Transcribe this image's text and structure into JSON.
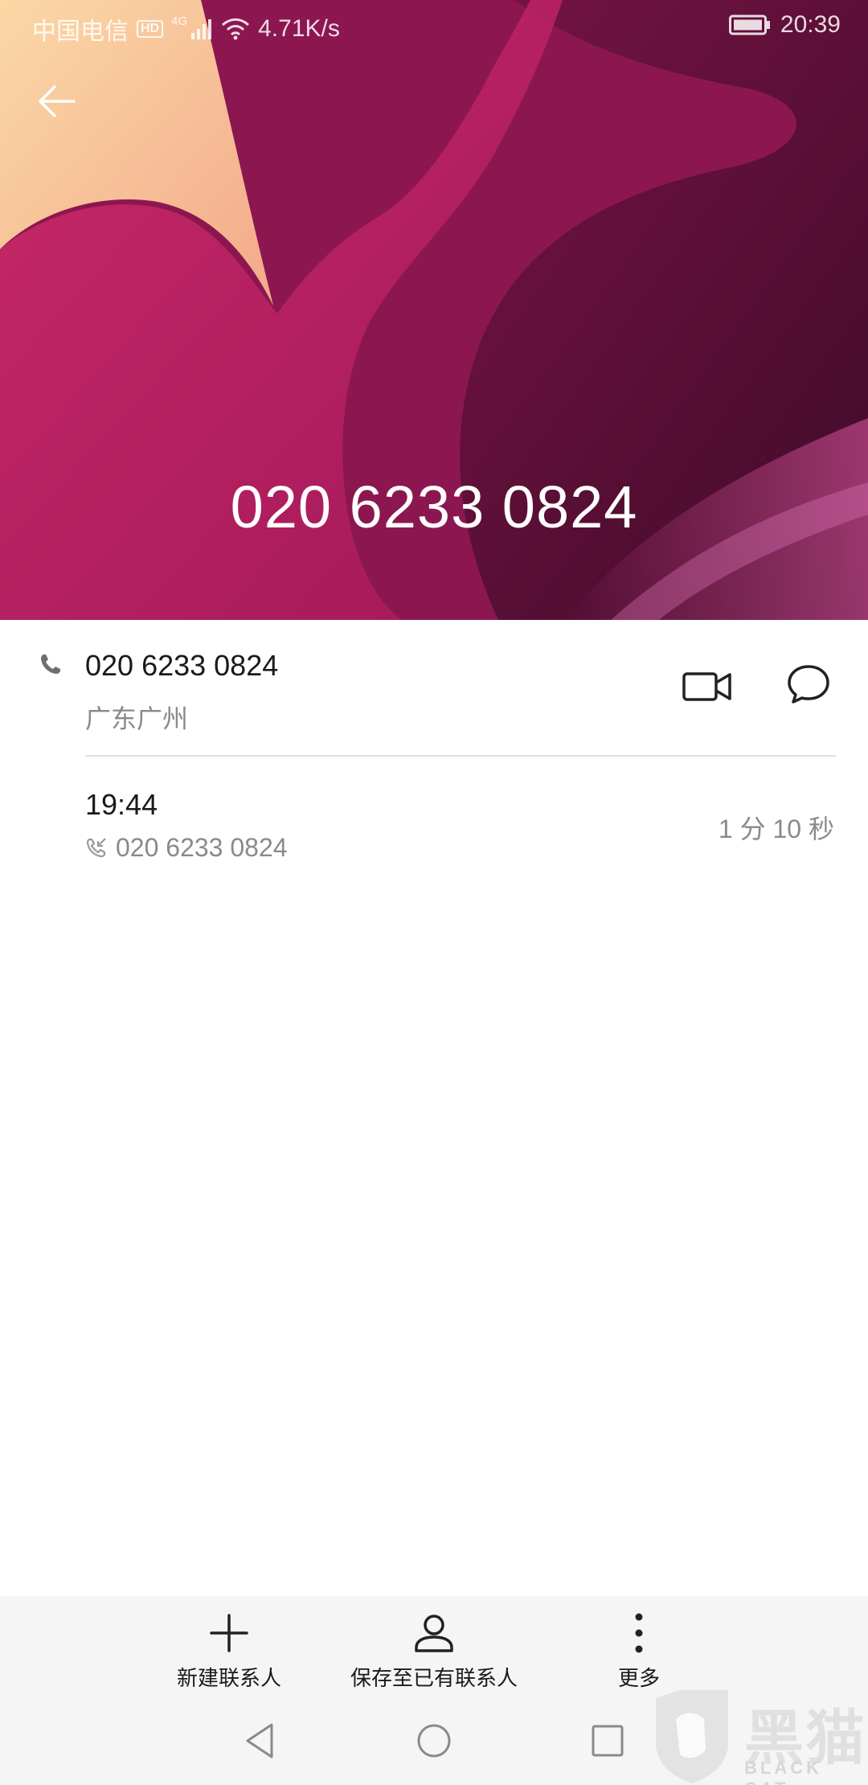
{
  "status_bar": {
    "carrier": "中国电信",
    "hd_badge": "HD",
    "network_type": "4G",
    "speed": "4.71K/s",
    "time": "20:39",
    "icons": [
      "signal-icon",
      "wifi-icon",
      "battery-icon"
    ]
  },
  "header": {
    "phone_number": "020 6233 0824",
    "back_icon": "arrow-left-icon"
  },
  "contact": {
    "number": "020 6233 0824",
    "location": "广东广州",
    "actions": [
      "video-call-icon",
      "message-icon"
    ]
  },
  "call_log": {
    "time": "19:44",
    "number": "020 6233 0824",
    "duration": "1 分 10 秒",
    "direction_icon": "incoming-call-icon"
  },
  "action_bar": {
    "new_contact_label": "新建联系人",
    "save_existing_label": "保存至已有联系人",
    "more_label": "更多"
  },
  "watermark": {
    "text": "黑猫",
    "sub": "BLACK CAT"
  },
  "colors": {
    "hero_primary": "#c0215f",
    "hero_dark": "#4a0f2e",
    "hero_light": "#f7c79a",
    "text_primary": "#1a1a1a",
    "text_secondary": "#8a8a8a",
    "bar_bg": "#f5f5f5"
  }
}
